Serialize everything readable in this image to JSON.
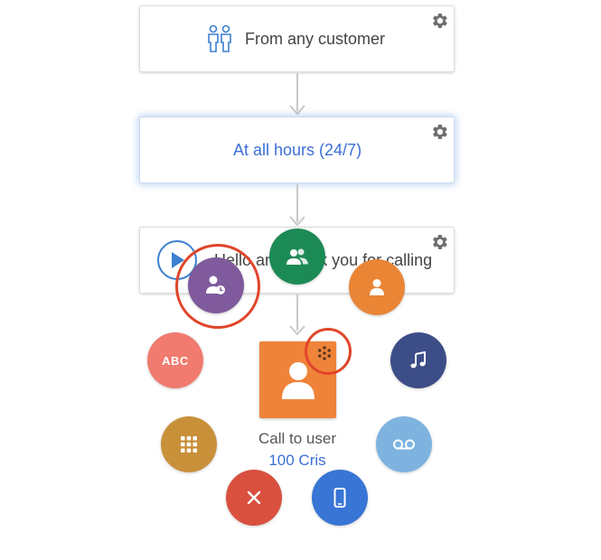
{
  "flow": {
    "customer_card": {
      "label": "From any customer",
      "icon": "customers-icon",
      "color": "#444444"
    },
    "hours_card": {
      "label": "At all hours (24/7)",
      "color": "#3d6fd6"
    },
    "greeting_card": {
      "label": "Hello and thank you for calling",
      "icon": "play-icon"
    }
  },
  "call_node": {
    "title": "Call to user",
    "user": "100 Cris",
    "box_color": "#f0833a",
    "user_color": "#3d6fd6"
  },
  "action_menu": [
    {
      "name": "transfer-user-action",
      "icon": "user-clock-icon",
      "color": "#7f5a9c"
    },
    {
      "name": "group-action",
      "icon": "group-icon",
      "color": "#1c8a55"
    },
    {
      "name": "user-action",
      "icon": "user-icon",
      "color": "#ea8536"
    },
    {
      "name": "text-to-speech-action",
      "icon": "abc-icon",
      "label": "ABC",
      "color": "#f07b6e"
    },
    {
      "name": "music-action",
      "icon": "music-note-icon",
      "color": "#3d4d87"
    },
    {
      "name": "ivr-menu-action",
      "icon": "keypad-icon",
      "color": "#c9903a"
    },
    {
      "name": "voicemail-action",
      "icon": "voicemail-icon",
      "color": "#7eb3e0"
    },
    {
      "name": "hangup-action",
      "icon": "close-icon",
      "color": "#d9503f"
    },
    {
      "name": "mobile-action",
      "icon": "mobile-icon",
      "color": "#3875d4"
    }
  ],
  "highlight_color": "#e0452a"
}
